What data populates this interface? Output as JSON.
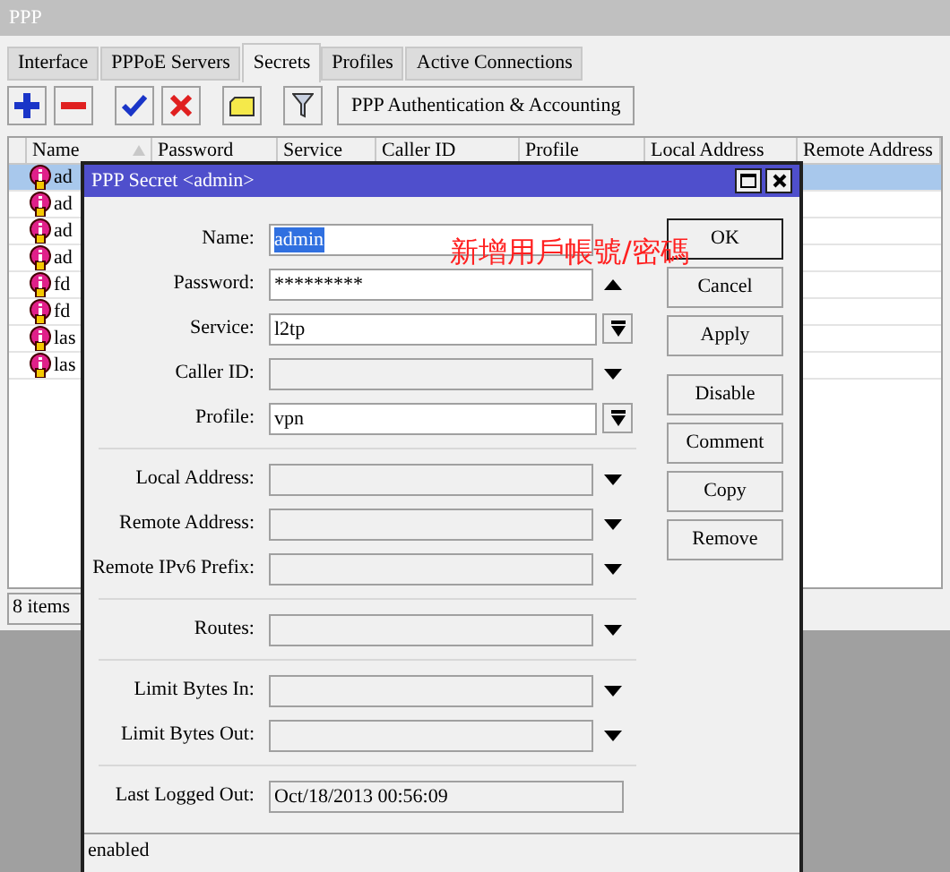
{
  "window": {
    "title": "PPP"
  },
  "tabs": [
    {
      "label": "Interface",
      "selected": false
    },
    {
      "label": "PPPoE Servers",
      "selected": false
    },
    {
      "label": "Secrets",
      "selected": true
    },
    {
      "label": "Profiles",
      "selected": false
    },
    {
      "label": "Active Connections",
      "selected": false
    }
  ],
  "toolbar": {
    "button": "PPP Authentication & Accounting"
  },
  "table": {
    "columns": [
      "Name",
      "Password",
      "Service",
      "Caller ID",
      "Profile",
      "Local Address",
      "Remote Address"
    ],
    "rows": [
      {
        "name": "ad",
        "selected": true
      },
      {
        "name": "ad",
        "selected": false
      },
      {
        "name": "ad",
        "selected": false
      },
      {
        "name": "ad",
        "selected": false
      },
      {
        "name": "fd",
        "selected": false
      },
      {
        "name": "fd",
        "selected": false
      },
      {
        "name": "las",
        "selected": false
      },
      {
        "name": "las",
        "selected": false
      }
    ]
  },
  "status_bar": "8 items",
  "dialog": {
    "title": "PPP Secret <admin>",
    "sections": [
      {
        "fields": [
          {
            "label": "Name:",
            "value": "admin",
            "kind": "text",
            "value_selected": true
          },
          {
            "label": "Password:",
            "value": "*********",
            "kind": "password",
            "value_selected": false
          },
          {
            "label": "Service:",
            "value": "l2tp",
            "kind": "select",
            "value_selected": false
          },
          {
            "label": "Caller ID:",
            "kind": "expand"
          },
          {
            "label": "Profile:",
            "value": "vpn",
            "kind": "select",
            "value_selected": false
          }
        ]
      },
      {
        "fields": [
          {
            "label": "Local Address:",
            "kind": "expand"
          },
          {
            "label": "Remote Address:",
            "kind": "expand"
          },
          {
            "label": "Remote IPv6 Prefix:",
            "kind": "expand"
          }
        ]
      },
      {
        "fields": [
          {
            "label": "Routes:",
            "kind": "expand"
          }
        ]
      },
      {
        "fields": [
          {
            "label": "Limit Bytes In:",
            "kind": "expand"
          },
          {
            "label": "Limit Bytes Out:",
            "kind": "expand"
          }
        ]
      },
      {
        "fields": [
          {
            "label": "Last Logged Out:",
            "value": "Oct/18/2013 00:56:09",
            "kind": "readonly",
            "value_selected": false
          }
        ]
      }
    ],
    "button_groups": [
      [
        {
          "label": "OK",
          "default": true
        },
        {
          "label": "Cancel",
          "default": false
        },
        {
          "label": "Apply",
          "default": false
        }
      ],
      [
        {
          "label": "Disable",
          "default": false
        },
        {
          "label": "Comment",
          "default": false
        },
        {
          "label": "Copy",
          "default": false
        },
        {
          "label": "Remove",
          "default": false
        }
      ]
    ],
    "status": "enabled",
    "annotation": "新增用戶帳號/密碼"
  }
}
